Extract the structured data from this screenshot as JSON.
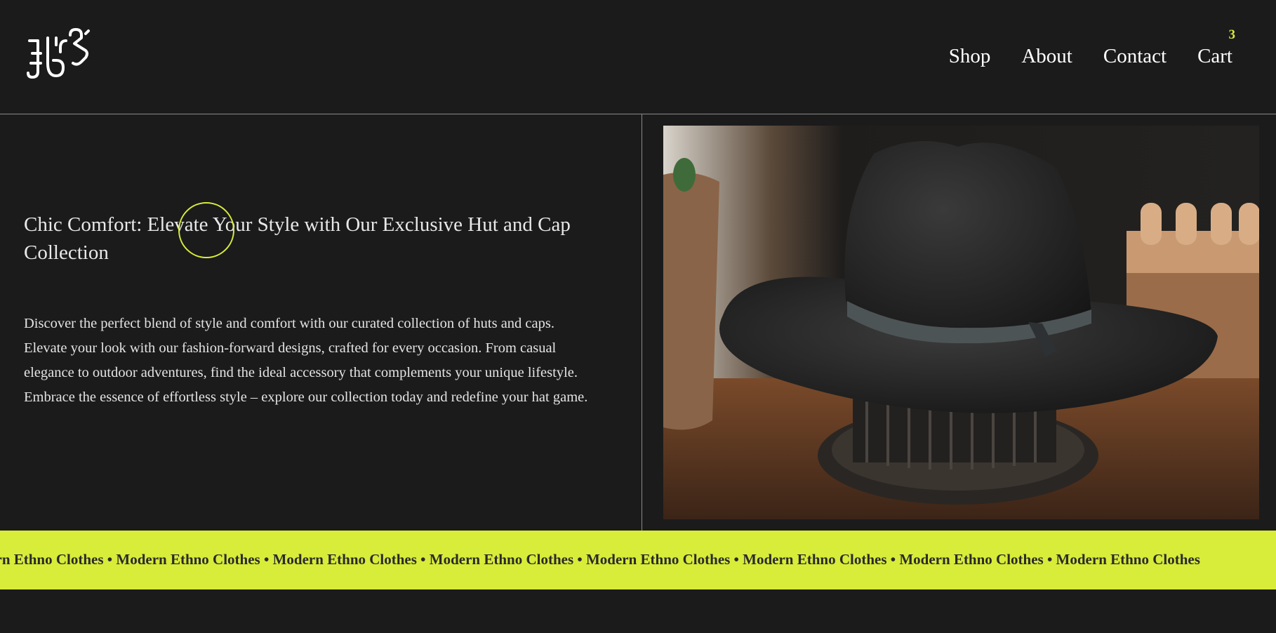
{
  "header": {
    "logo_name": "brand-logo",
    "nav": {
      "shop": "Shop",
      "about": "About",
      "contact": "Contact",
      "cart": "Cart",
      "cart_count": "3"
    }
  },
  "hero": {
    "title": "Chic Comfort: Elevate Your Style with Our Exclusive Hut and Cap Collection",
    "body": "Discover the perfect blend of style and comfort with our curated collection of huts and caps. Elevate your look with our fashion-forward designs, crafted for every occasion. From casual elegance to outdoor adventures, find the ideal accessory that complements your unique lifestyle. Embrace the essence of effortless style – explore our collection today and redefine your hat game."
  },
  "marquee": {
    "text": "odern Ethno Clothes • Modern Ethno Clothes • Modern Ethno Clothes • Modern Ethno Clothes • Modern Ethno Clothes • Modern Ethno Clothes  • Modern Ethno Clothes • Modern Ethno Clothes"
  },
  "colors": {
    "background": "#1b1b1c",
    "accent": "#d8ec3a",
    "text": "#e8e8e8"
  }
}
